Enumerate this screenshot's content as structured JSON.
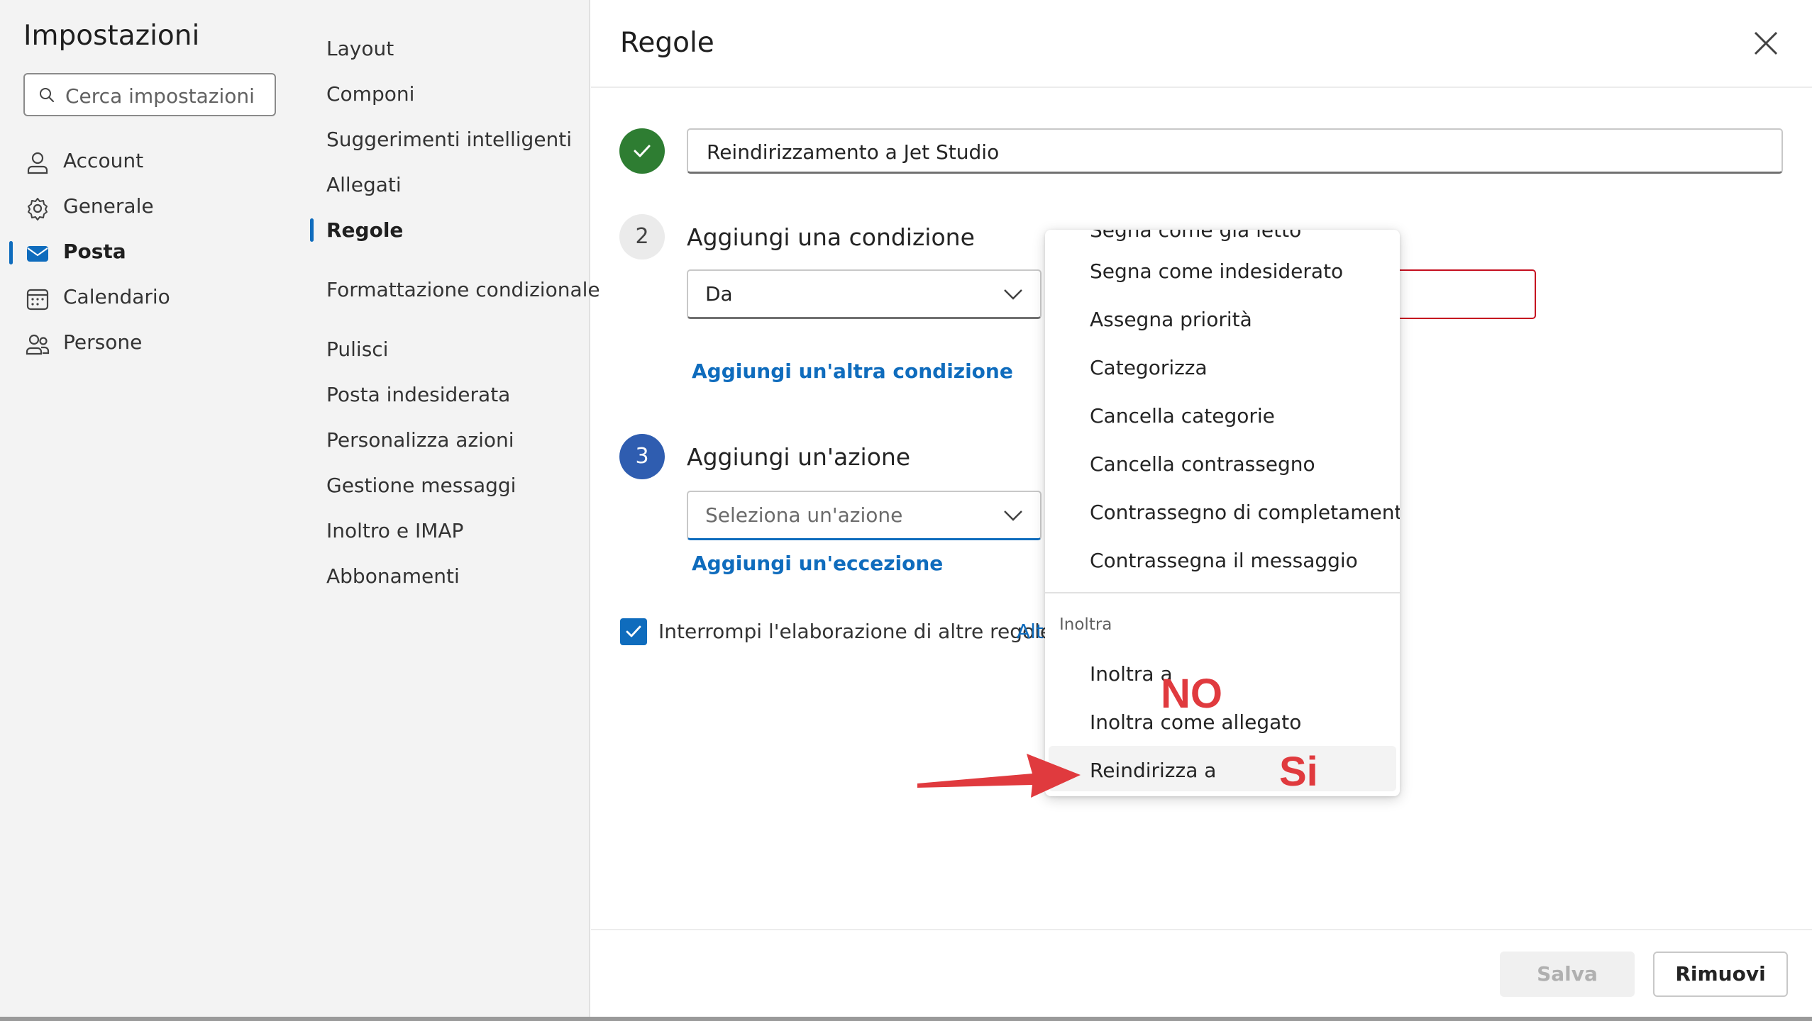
{
  "sidebar": {
    "title": "Impostazioni",
    "search_placeholder": "Cerca impostazioni",
    "items": [
      {
        "label": "Account",
        "icon": "person-icon"
      },
      {
        "label": "Generale",
        "icon": "gear-icon"
      },
      {
        "label": "Posta",
        "icon": "mail-icon",
        "active": true
      },
      {
        "label": "Calendario",
        "icon": "calendar-icon"
      },
      {
        "label": "Persone",
        "icon": "people-icon"
      }
    ]
  },
  "subnav": {
    "items": [
      {
        "label": "Layout"
      },
      {
        "label": "Componi"
      },
      {
        "label": "Suggerimenti intelligenti"
      },
      {
        "label": "Allegati"
      },
      {
        "label": "Regole",
        "active": true
      },
      {
        "label": "Formattazione condizionale"
      },
      {
        "label": "Pulisci"
      },
      {
        "label": "Posta indesiderata"
      },
      {
        "label": "Personalizza azioni"
      },
      {
        "label": "Gestione messaggi"
      },
      {
        "label": "Inoltro e IMAP"
      },
      {
        "label": "Abbonamenti"
      }
    ]
  },
  "main": {
    "title": "Regole",
    "rule_name": "Reindirizzamento a Jet Studio",
    "step2": {
      "number": "2",
      "label": "Aggiungi una condizione",
      "dropdown_value": "Da",
      "add_link": "Aggiungi un'altra condizione"
    },
    "step3": {
      "number": "3",
      "label": "Aggiungi un'azione",
      "dropdown_placeholder": "Seleziona un'azione",
      "add_link": "Aggiungi un'eccezione"
    },
    "stop_processing": {
      "label": "Interrompi l'elaborazione di altre regole",
      "checked": true,
      "link": "Altr"
    },
    "save_label": "Salva",
    "remove_label": "Rimuovi"
  },
  "action_menu": {
    "partial_top_item": "Segna come già letto",
    "items": [
      "Segna come indesiderato",
      "Assegna priorità",
      "Categorizza",
      "Cancella categorie",
      "Cancella contrassegno",
      "Contrassegno di completamento",
      "Contrassegna il messaggio"
    ],
    "section_header": "Inoltra",
    "forward_items": [
      "Inoltra a",
      "Inoltra come allegato",
      "Reindirizza a"
    ],
    "hovered_item": "Reindirizza a"
  },
  "annotations": {
    "no": "NO",
    "si": "Si",
    "color": "#e03a3e"
  },
  "colors": {
    "accent": "#0f6cbd",
    "success": "#2e7d32",
    "step_active": "#2f5db0",
    "error": "#c50f1f"
  }
}
